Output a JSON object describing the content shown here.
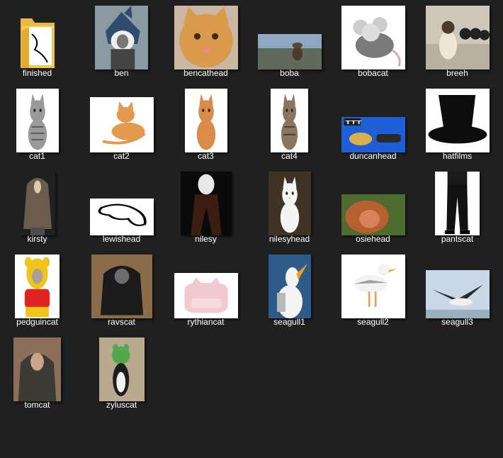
{
  "folder": {
    "items": [
      {
        "label": "finished",
        "kind": "folder",
        "icon": "folder-icon"
      },
      {
        "label": "ben",
        "kind": "image",
        "icon": "cat-shark-costume-thumbnail"
      },
      {
        "label": "bencathead",
        "kind": "image",
        "icon": "orange-cat-face-thumbnail"
      },
      {
        "label": "boba",
        "kind": "image",
        "icon": "game-scene-figure-thumbnail"
      },
      {
        "label": "bobacat",
        "kind": "image",
        "icon": "mouse-plush-cat-thumbnail"
      },
      {
        "label": "breeh",
        "kind": "image",
        "icon": "siamese-cat-sheep-thumbnail"
      },
      {
        "label": "cat1",
        "kind": "image",
        "icon": "tabby-cat-thumbnail"
      },
      {
        "label": "cat2",
        "kind": "image",
        "icon": "orange-kitten-thumbnail"
      },
      {
        "label": "cat3",
        "kind": "image",
        "icon": "standing-orange-cat-thumbnail"
      },
      {
        "label": "cat4",
        "kind": "image",
        "icon": "standing-tabby-cat-thumbnail"
      },
      {
        "label": "duncanhead",
        "kind": "image",
        "icon": "game-banner-thumbnail"
      },
      {
        "label": "hatfilms",
        "kind": "image",
        "icon": "top-hat-thumbnail"
      },
      {
        "label": "kirsty",
        "kind": "image",
        "icon": "cloaked-figure-thumbnail"
      },
      {
        "label": "lewishead",
        "kind": "image",
        "icon": "outline-drawing-thumbnail"
      },
      {
        "label": "nilesy",
        "kind": "image",
        "icon": "cat-with-legs-thumbnail"
      },
      {
        "label": "nilesyhead",
        "kind": "image",
        "icon": "white-cat-thumbnail"
      },
      {
        "label": "osiehead",
        "kind": "image",
        "icon": "monkey-face-thumbnail"
      },
      {
        "label": "pantscat",
        "kind": "image",
        "icon": "black-pants-thumbnail"
      },
      {
        "label": "pedguincat",
        "kind": "image",
        "icon": "pooh-costume-cat-thumbnail"
      },
      {
        "label": "ravscat",
        "kind": "image",
        "icon": "hooded-cat-thumbnail"
      },
      {
        "label": "rythiancat",
        "kind": "image",
        "icon": "pink-cat-chair-thumbnail"
      },
      {
        "label": "seagull1",
        "kind": "image",
        "icon": "seagull-squawk-thumbnail"
      },
      {
        "label": "seagull2",
        "kind": "image",
        "icon": "seagull-standing-thumbnail"
      },
      {
        "label": "seagull3",
        "kind": "image",
        "icon": "seagull-flying-thumbnail"
      },
      {
        "label": "tomcat",
        "kind": "image",
        "icon": "cat-in-hoodie-thumbnail"
      },
      {
        "label": "zyluscat",
        "kind": "image",
        "icon": "frog-hat-cat-thumbnail"
      }
    ]
  },
  "colors": {
    "background": "#202020",
    "label_text": "#ffffff",
    "folder_yellow": "#f2c94c"
  }
}
